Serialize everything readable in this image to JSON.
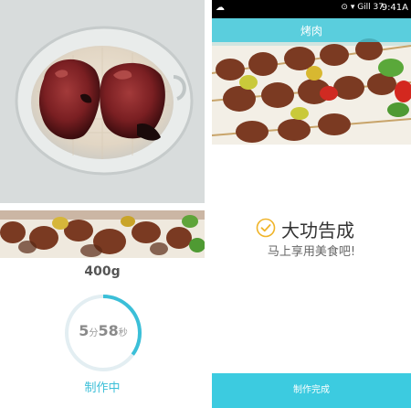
{
  "left_panel": {
    "weight": "400g",
    "timer": {
      "minutes": "5",
      "minutes_unit": "分",
      "seconds": "58",
      "seconds_unit": "秒",
      "progress": 0.35
    },
    "status": "制作中"
  },
  "right_panel": {
    "statusbar": {
      "left_icons": "☁",
      "right_icons": "⊙ ▾ Gill 37",
      "clock": "9:41A"
    },
    "title": "烤肉",
    "done_title": "大功告成",
    "done_subtitle": "马上享用美食吧!",
    "finish_button": "制作完成"
  },
  "colors": {
    "accent": "#3bbfd8",
    "button": "#3ccbe0",
    "check": "#f0b429"
  }
}
